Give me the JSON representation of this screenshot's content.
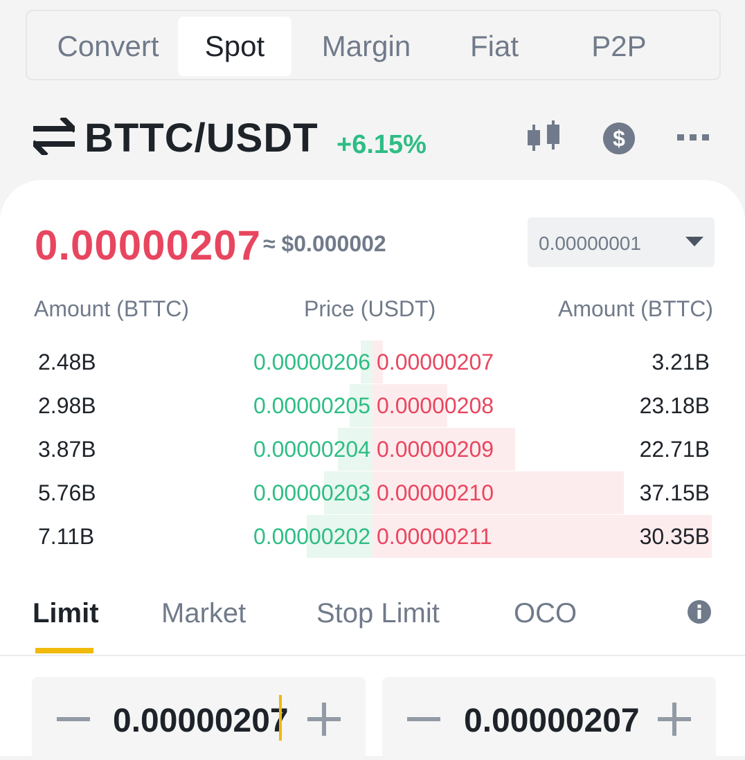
{
  "tabs": [
    {
      "label": "Convert",
      "active": false
    },
    {
      "label": "Spot",
      "active": true
    },
    {
      "label": "Margin",
      "active": false
    },
    {
      "label": "Fiat",
      "active": false
    },
    {
      "label": "P2P",
      "active": false
    }
  ],
  "pair": {
    "name": "BTTC/USDT",
    "change": "+6.15%",
    "icons": [
      "swap-arrows-icon",
      "candlestick-chart-icon",
      "dollar-icon",
      "more-icon"
    ]
  },
  "price": {
    "last": "0.00000207",
    "approx": "≈ $0.000002",
    "precision": "0.00000001"
  },
  "book": {
    "headers": {
      "bid_amount": "Amount (BTTC)",
      "price": "Price (USDT)",
      "ask_amount": "Amount (BTTC)"
    },
    "rows": [
      {
        "bid_amount": "2.48B",
        "bid_price": "0.00000206",
        "ask_price": "0.00000207",
        "ask_amount": "3.21B",
        "bid_depth": 0.04,
        "ask_depth": 0.03
      },
      {
        "bid_amount": "2.98B",
        "bid_price": "0.00000205",
        "ask_price": "0.00000208",
        "ask_amount": "23.18B",
        "bid_depth": 0.08,
        "ask_depth": 0.22
      },
      {
        "bid_amount": "3.87B",
        "bid_price": "0.00000204",
        "ask_price": "0.00000209",
        "ask_amount": "22.71B",
        "bid_depth": 0.12,
        "ask_depth": 0.42
      },
      {
        "bid_amount": "5.76B",
        "bid_price": "0.00000203",
        "ask_price": "0.00000210",
        "ask_amount": "37.15B",
        "bid_depth": 0.17,
        "ask_depth": 0.74
      },
      {
        "bid_amount": "7.11B",
        "bid_price": "0.00000202",
        "ask_price": "0.00000211",
        "ask_amount": "30.35B",
        "bid_depth": 0.23,
        "ask_depth": 1.0
      }
    ]
  },
  "order_types": [
    {
      "label": "Limit",
      "active": true
    },
    {
      "label": "Market",
      "active": false
    },
    {
      "label": "Stop Limit",
      "active": false
    },
    {
      "label": "OCO",
      "active": false
    }
  ],
  "inputs": {
    "price_value": "0.00000207",
    "second_value": "0.00000207"
  },
  "colors": {
    "accent": "#f0b90b",
    "buy": "#2ebd85",
    "sell": "#e8465f"
  }
}
